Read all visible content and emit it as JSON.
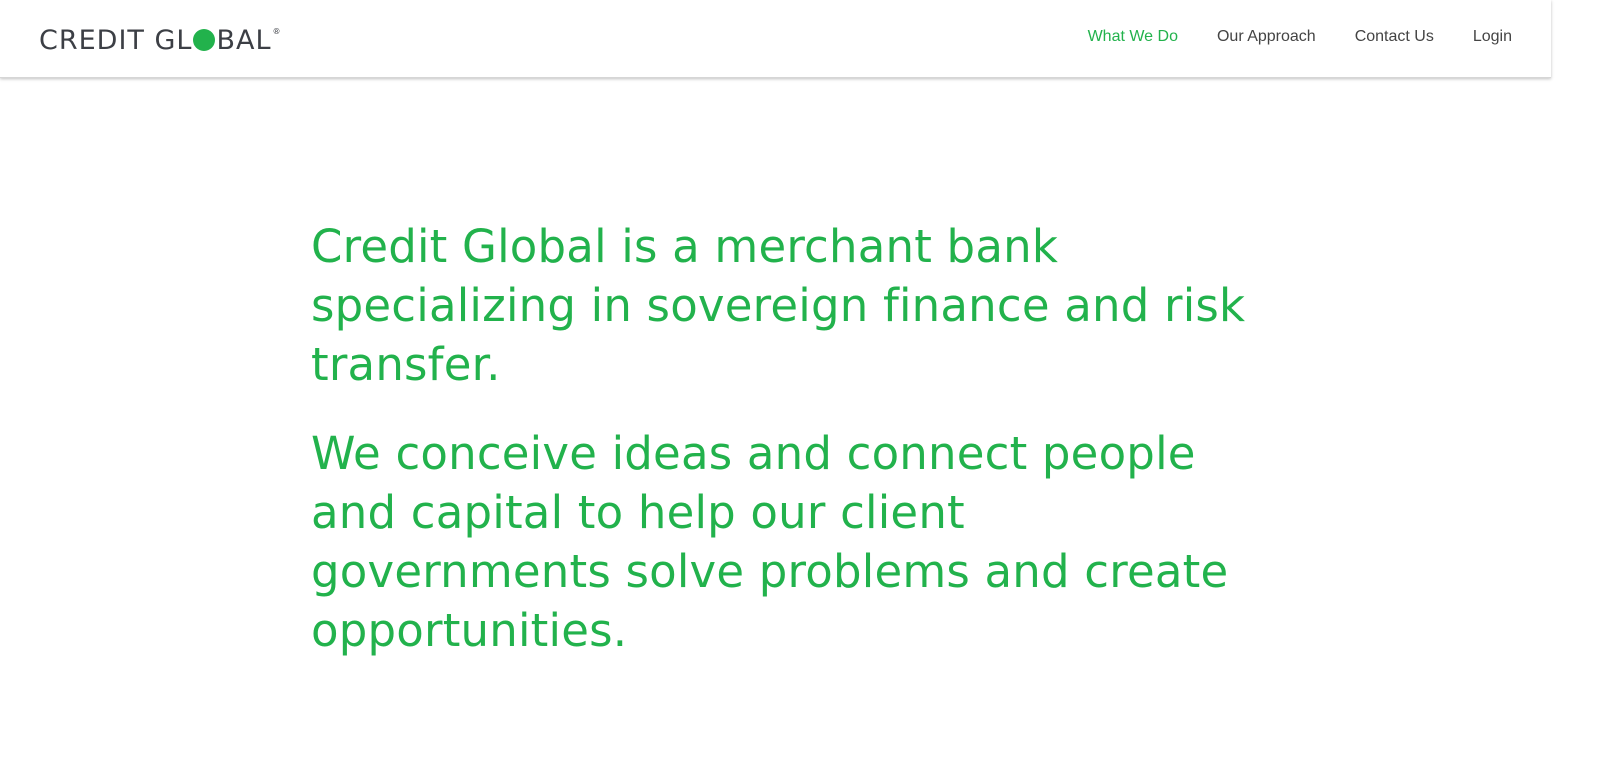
{
  "colors": {
    "brand_green": "#22b24c",
    "logo_gray": "#3c3f45",
    "nav_text": "#444444"
  },
  "header": {
    "logo": {
      "text_before": "CREDIT GL",
      "dot_icon": "green-circle-o",
      "text_after": "BAL",
      "registered": "®"
    },
    "nav": [
      {
        "label": "What We Do",
        "active": true
      },
      {
        "label": "Our Approach",
        "active": false
      },
      {
        "label": "Contact Us",
        "active": false
      },
      {
        "label": "Login",
        "active": false
      }
    ]
  },
  "main": {
    "paragraphs": [
      "Credit Global is a merchant bank specializing in sovereign finance and risk transfer.",
      "We conceive ideas and connect people and capital to help our client governments solve problems and create opportunities."
    ]
  }
}
